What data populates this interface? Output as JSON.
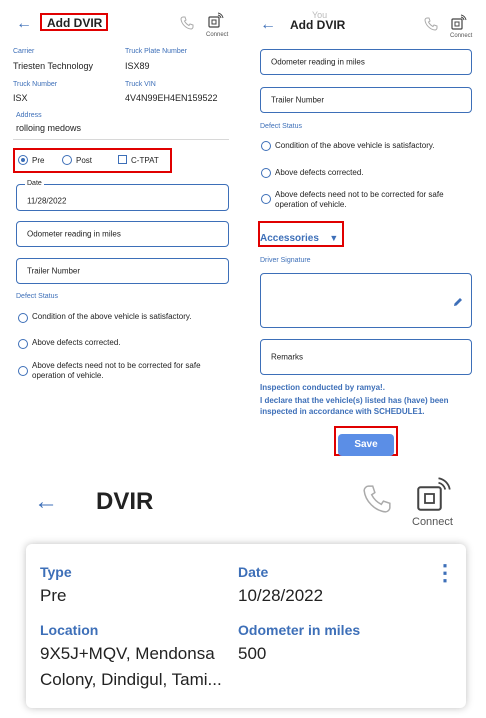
{
  "left": {
    "back_glyph": "←",
    "title": "Add DVIR",
    "connect_label": "Connect",
    "carrier_label": "Carrier",
    "carrier_value": "Triesten Technology",
    "plate_label": "Truck Plate Number",
    "plate_value": "ISX89",
    "truck_number_label": "Truck Number",
    "truck_number_value": "ISX",
    "vin_label": "Truck VIN",
    "vin_value": "4V4N99EH4EN159522",
    "address_label": "Address",
    "address_value": "rolloing medows",
    "inspection_types": [
      "Pre",
      "Post",
      "C-TPAT"
    ],
    "selected_type": "Pre",
    "date_label": "Date",
    "date_value": "11/28/2022",
    "odometer_placeholder": "Odometer reading in miles",
    "trailer_placeholder": "Trailer Number",
    "defect_status_label": "Defect Status",
    "defect_options": [
      "Condition of the above vehicle is satisfactory.",
      "Above defects corrected.",
      "Above defects need not to be corrected for safe operation of vehicle."
    ]
  },
  "right": {
    "back_glyph": "←",
    "title": "Add DVIR",
    "overlay_text": "You",
    "connect_label": "Connect",
    "odometer_placeholder": "Odometer reading in miles",
    "trailer_placeholder": "Trailer Number",
    "defect_status_label": "Defect Status",
    "defect_options": [
      "Condition of the above vehicle is satisfactory.",
      "Above defects corrected.",
      "Above defects need not to be corrected for safe operation of vehicle."
    ],
    "accessories_label": "Accessories",
    "accessories_arrow": "▼",
    "driver_signature_label": "Driver Signature",
    "remarks_placeholder": "Remarks",
    "inspection_by": "Inspection conducted by ramya!.",
    "declaration": "I declare that the vehicle(s) listed has (have) been inspected in accordance with SCHEDULE1.",
    "save_label": "Save"
  },
  "bottom": {
    "back_glyph": "←",
    "title": "DVIR",
    "connect_label": "Connect",
    "type_label": "Type",
    "type_value": "Pre",
    "date_label": "Date",
    "date_value": "10/28/2022",
    "location_label": "Location",
    "location_line1": "9X5J+MQV, Mendonsa",
    "location_line2": "Colony, Dindigul, Tami...",
    "odometer_label": "Odometer in miles",
    "odometer_value": "500",
    "menu_glyph": "⋮"
  },
  "colors": {
    "accent": "#3d6fb8",
    "highlight": "#e00000",
    "save_button": "#5b8ee6"
  },
  "icons": [
    "back-arrow-icon",
    "phone-icon",
    "connect-icon",
    "edit-pencil-icon",
    "dropdown-arrow-icon",
    "more-vertical-icon"
  ]
}
